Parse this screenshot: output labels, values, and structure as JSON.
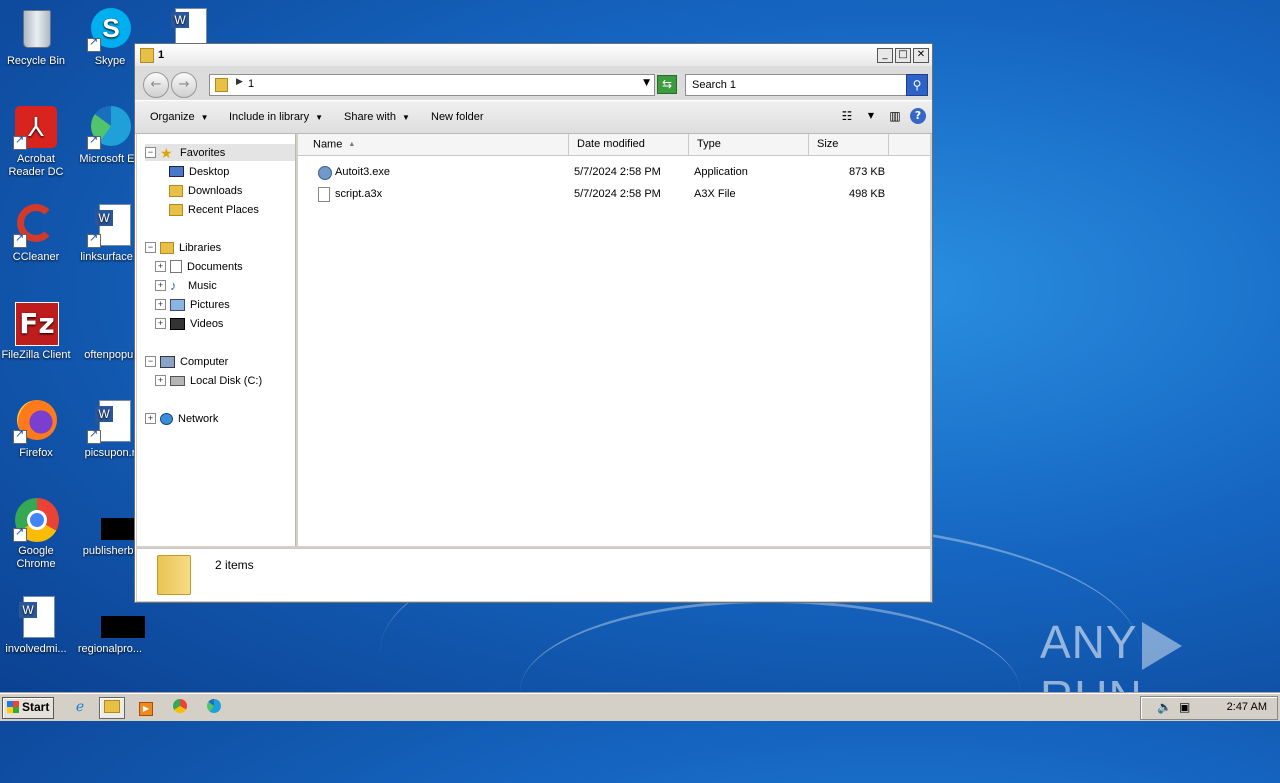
{
  "desktop": {
    "icons_col1": [
      {
        "label": "Recycle Bin",
        "icon": "recycle-bin-icon",
        "color": "#c8d3df"
      },
      {
        "label": "Acrobat Reader DC",
        "icon": "acrobat-icon",
        "color": "#d9231f"
      },
      {
        "label": "CCleaner",
        "icon": "ccleaner-icon",
        "color": "#d43a2a"
      },
      {
        "label": "FileZilla Client",
        "icon": "filezilla-icon",
        "color": "#bf1c1c"
      },
      {
        "label": "Firefox",
        "icon": "firefox-icon",
        "color": "#ff7a1a"
      },
      {
        "label": "Google Chrome",
        "icon": "chrome-icon",
        "color": "#34a853"
      },
      {
        "label": "involvedmi...",
        "icon": "word-document-icon",
        "color": "#ffffff"
      }
    ],
    "icons_col2": [
      {
        "label": "Skype",
        "icon": "skype-icon",
        "color": "#00aff0"
      },
      {
        "label": "Microsoft Ed",
        "icon": "edge-icon",
        "color": "#1fa0d8"
      },
      {
        "label": "linksurface.r",
        "icon": "word-document-icon",
        "color": "#ffffff"
      },
      {
        "label": "oftenpopul",
        "icon": "blank-file-icon",
        "color": "#1a5fc0"
      },
      {
        "label": "picsupon.r",
        "icon": "word-document-icon",
        "color": "#ffffff"
      },
      {
        "label": "publisherbr",
        "icon": "black-thumbnail-icon",
        "color": "#000000"
      },
      {
        "label": "regionalpro...",
        "icon": "black-thumbnail-icon",
        "color": "#000000"
      }
    ]
  },
  "window": {
    "title": "1",
    "address": {
      "crumb": "1"
    },
    "search": {
      "placeholder": "Search 1"
    },
    "toolbar": {
      "organize": "Organize",
      "include_in_library": "Include in library",
      "share_with": "Share with",
      "new_folder": "New folder"
    },
    "nav": {
      "favorites": "Favorites",
      "desktop": "Desktop",
      "downloads": "Downloads",
      "recent_places": "Recent Places",
      "libraries": "Libraries",
      "documents": "Documents",
      "music": "Music",
      "pictures": "Pictures",
      "videos": "Videos",
      "computer": "Computer",
      "local_disk": "Local Disk (C:)",
      "network": "Network"
    },
    "columns": {
      "name": "Name",
      "date_modified": "Date modified",
      "type": "Type",
      "size": "Size"
    },
    "files": [
      {
        "name": "Autoit3.exe",
        "date_modified": "5/7/2024 2:58 PM",
        "type": "Application",
        "size": "873 KB",
        "icon": "autoit-app-icon"
      },
      {
        "name": "script.a3x",
        "date_modified": "5/7/2024 2:58 PM",
        "type": "A3X File",
        "size": "498 KB",
        "icon": "file-icon"
      }
    ],
    "details": {
      "count": "2 items"
    }
  },
  "watermark": {
    "left": "ANY",
    "right": "RUN"
  },
  "taskbar": {
    "start_label": "Start",
    "apps": [
      "ie-icon",
      "explorer-icon",
      "media-player-icon",
      "chrome-icon",
      "edge-icon"
    ],
    "clock": "2:47 AM"
  }
}
